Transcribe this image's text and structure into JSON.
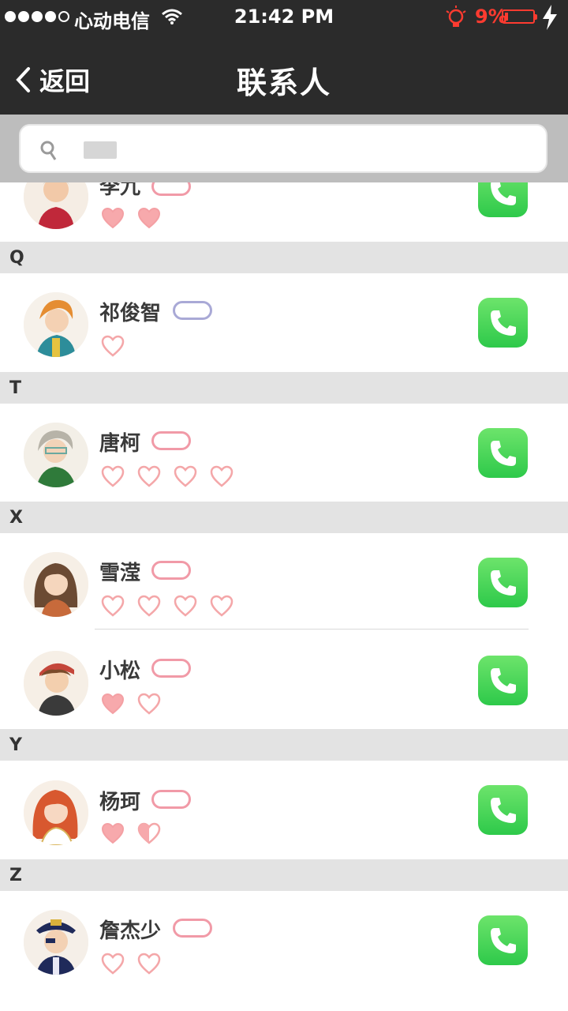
{
  "status_bar": {
    "carrier": "心动电信",
    "time": "21:42 PM",
    "battery_percent": "9%",
    "battery_level": 0.09,
    "signal_bars": 4,
    "colors": {
      "battery_low": "#ff3b30"
    }
  },
  "nav": {
    "back_label": "返回",
    "title": "联系人"
  },
  "search": {
    "placeholder": "",
    "value": ""
  },
  "colors": {
    "nav_bg": "#2b2b2b",
    "search_bg": "#bdbdbd",
    "section_bg": "#e3e3e3",
    "call_green": "#35cc4c",
    "heart_pink": "#f4a7a9"
  },
  "contacts": [
    {
      "section": null,
      "name": "李九",
      "badge": "pink",
      "hearts": [
        "full",
        "full"
      ],
      "partially_hidden": true
    },
    {
      "section": "Q",
      "name": "祁俊智",
      "badge": "blue",
      "hearts": [
        "empty"
      ]
    },
    {
      "section": "T",
      "name": "唐柯",
      "badge": "pink",
      "hearts": [
        "empty",
        "empty",
        "empty",
        "empty"
      ]
    },
    {
      "section": "X",
      "name": "雪滢",
      "badge": "pink",
      "hearts": [
        "empty",
        "empty",
        "empty",
        "empty"
      ]
    },
    {
      "section": null,
      "name": "小松",
      "badge": "pink",
      "hearts": [
        "full",
        "empty"
      ]
    },
    {
      "section": "Y",
      "name": "杨珂",
      "badge": "pink",
      "hearts": [
        "full",
        "half"
      ]
    },
    {
      "section": "Z",
      "name": "詹杰少",
      "badge": "pink",
      "hearts": [
        "empty",
        "empty"
      ]
    }
  ],
  "sections": [
    "Q",
    "T",
    "X",
    "Y",
    "Z"
  ],
  "icons": {
    "back": "chevron-left-icon",
    "search": "search-icon",
    "call": "phone-icon",
    "heart": "heart-icon"
  }
}
